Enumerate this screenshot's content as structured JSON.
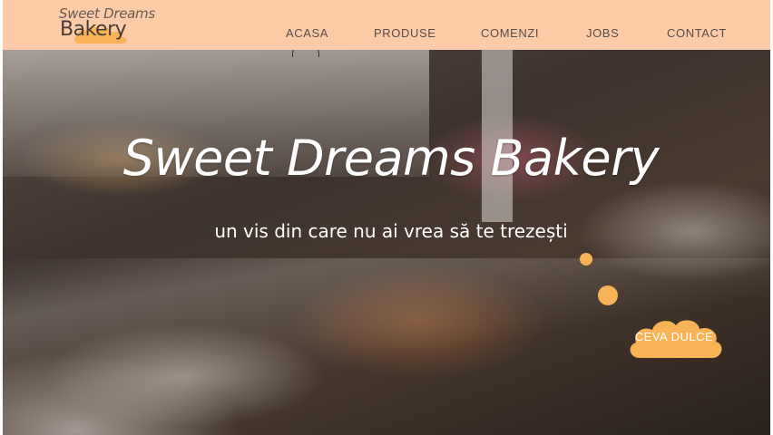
{
  "logo": {
    "line1": "Sweet Dreams",
    "line2": "Bakery"
  },
  "nav": {
    "items": [
      "ACASA",
      "PRODUSE",
      "COMENZI",
      "JOBS",
      "CONTACT"
    ],
    "active": "ACASA"
  },
  "hero": {
    "title": "Sweet Dreams Bakery",
    "subtitle": "un vis din care nu ai vrea să te trezești",
    "cta": "CEVA DULCE"
  },
  "colors": {
    "header_bg": "#fccba8",
    "accent": "#f7b356",
    "text_dark": "#5b4d47"
  }
}
